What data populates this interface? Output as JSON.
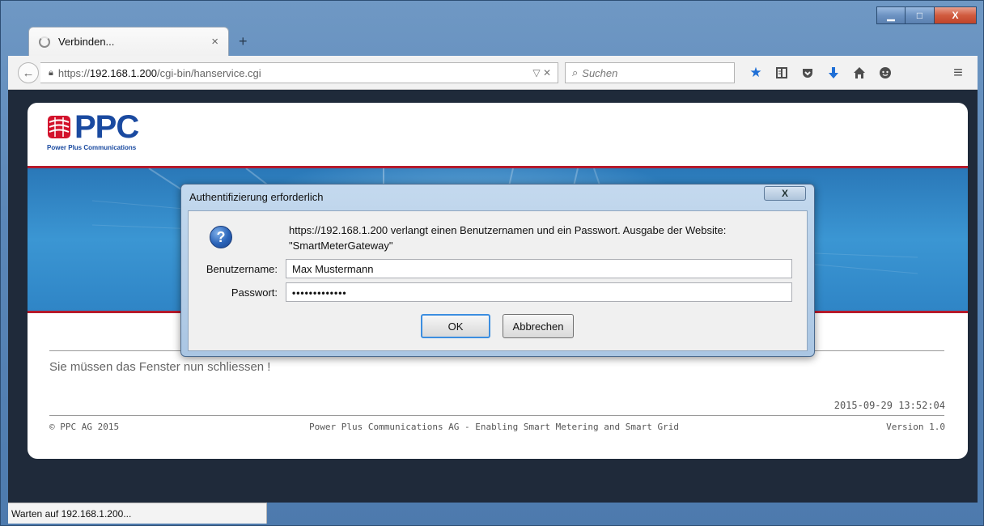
{
  "window": {
    "minimize_label": "▁",
    "maximize_label": "□",
    "close_label": "X"
  },
  "tab": {
    "title": "Verbinden...",
    "close_label": "×",
    "new_tab_label": "+"
  },
  "navbar": {
    "back_label": "←",
    "url_prefix": "https://",
    "url_host": "192.168.1.200",
    "url_path": "/cgi-bin/hanservice.cgi",
    "url_actions": "▽ ✕",
    "search_placeholder": "Suchen",
    "icons": [
      "star-icon",
      "reading-list-icon",
      "pocket-icon",
      "download-icon",
      "home-icon",
      "chat-icon",
      "menu-icon"
    ]
  },
  "page": {
    "logo_text": "PPC",
    "logo_subtitle": "Power Plus Communications",
    "close_message": "Sie müssen das Fenster nun schliessen !",
    "timestamp": "2015-09-29 13:52:04",
    "copyright": "© PPC AG 2015",
    "company_tagline": "Power Plus Communications AG - Enabling Smart Metering and Smart Grid",
    "version": "Version 1.0"
  },
  "statusbar": {
    "text": "Warten auf 192.168.1.200..."
  },
  "dialog": {
    "title": "Authentifizierung erforderlich",
    "close_label": "X",
    "message_line1": "https://192.168.1.200 verlangt einen Benutzernamen und ein Passwort. Ausgabe der Website:",
    "message_line2": "\"SmartMeterGateway\"",
    "username_label": "Benutzername:",
    "username_value": "Max Mustermann",
    "password_label": "Passwort:",
    "password_value": "•••••••••••••",
    "ok_label": "OK",
    "cancel_label": "Abbrechen"
  },
  "colors": {
    "brand_blue": "#1a4aa0",
    "brand_red": "#b51a2c",
    "banner_blue": "#3b96d3"
  }
}
